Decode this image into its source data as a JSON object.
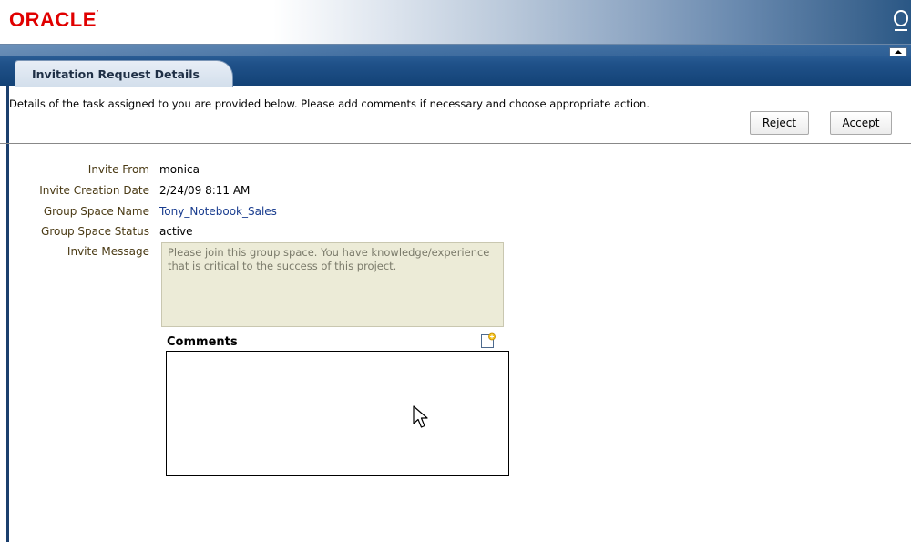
{
  "header": {
    "logo_text": "ORACLE",
    "brand_color": "#e00000"
  },
  "tab": {
    "label": "Invitation Request Details"
  },
  "instructions": "Details of the task assigned to you are provided below. Please add comments if necessary and choose appropriate action.",
  "actions": {
    "reject_label": "Reject",
    "accept_label": "Accept"
  },
  "details": [
    {
      "label": "Invite From",
      "value": "monica"
    },
    {
      "label": "Invite Creation Date",
      "value": "2/24/09 8:11 AM"
    },
    {
      "label": "Group Space Name",
      "value": "Tony_Notebook_Sales"
    },
    {
      "label": "Group Space Status",
      "value": "active"
    },
    {
      "label": "Invite Message",
      "value": ""
    }
  ],
  "invite_message": "Please join this group space. You have knowledge/experience that is critical to the success of this project.",
  "comments": {
    "title": "Comments",
    "value": ""
  },
  "icons": {
    "header_right": "search-icon",
    "comments_add": "add-comment-icon",
    "collapse": "collapse-up-icon"
  }
}
